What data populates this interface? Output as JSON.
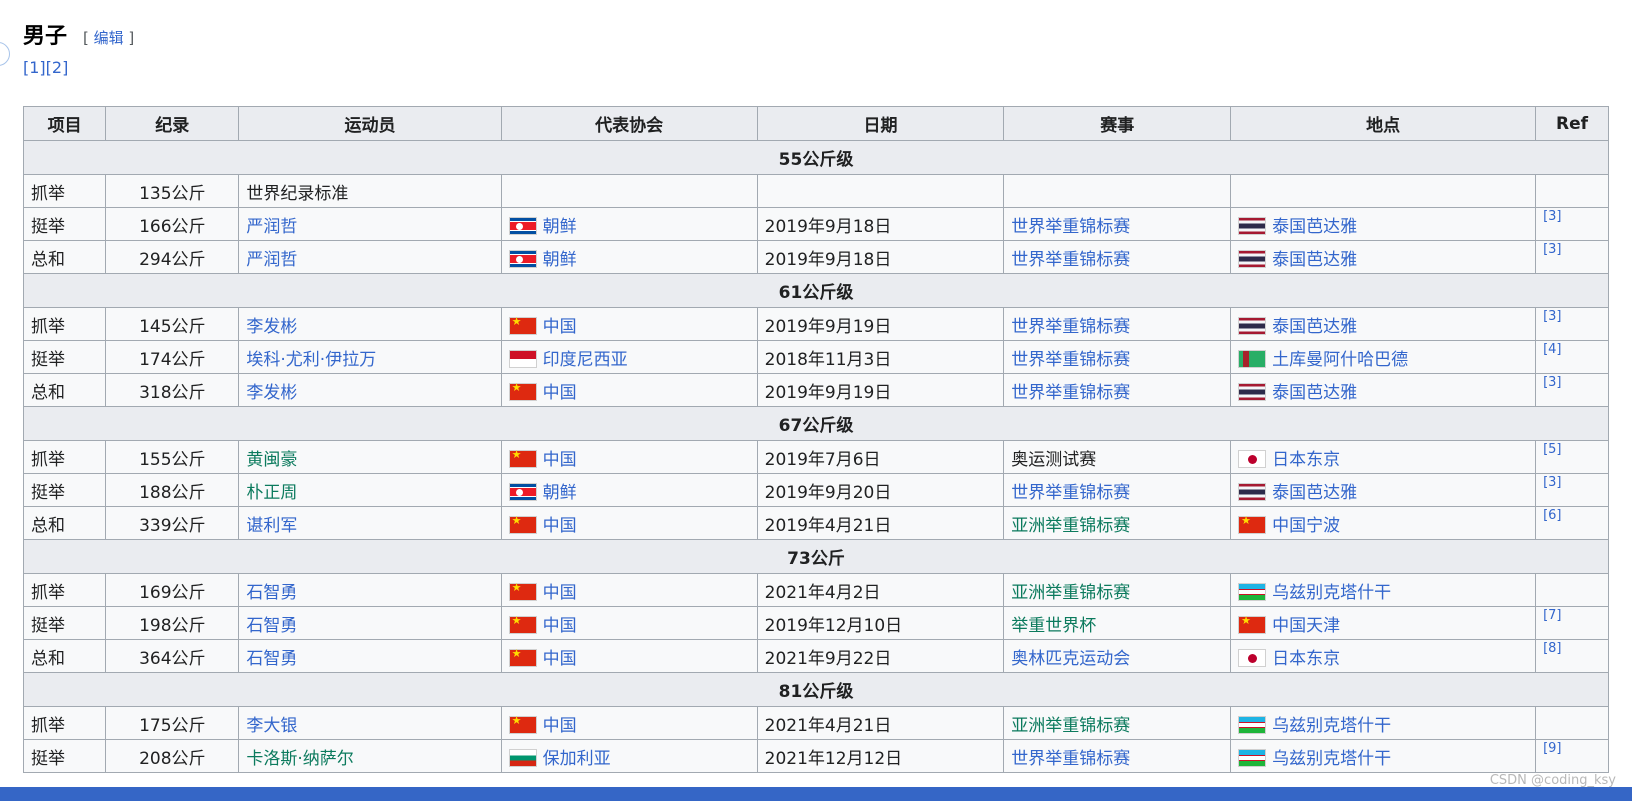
{
  "section": {
    "title": "男子",
    "edit_open": "[ ",
    "edit_label": "编辑",
    "edit_close": " ]",
    "ref1": "[1]",
    "ref2": "[2]"
  },
  "table": {
    "headers": [
      "项目",
      "纪录",
      "运动员",
      "代表协会",
      "日期",
      "赛事",
      "地点",
      "Ref"
    ],
    "groups": [
      "55公斤级",
      "61公斤级",
      "67公斤级",
      "73公斤",
      "81公斤级"
    ],
    "rows": [
      {
        "event": "抓举",
        "record": "135公斤",
        "athlete": "世界纪录标准",
        "nation": "",
        "date": "",
        "competition": "",
        "place": "",
        "ref": ""
      },
      {
        "event": "挺举",
        "record": "166公斤",
        "athlete": "严润哲",
        "nation": "朝鲜",
        "date": "2019年9月18日",
        "competition": "世界举重锦标赛",
        "place": "泰国芭达雅",
        "ref": "[3]"
      },
      {
        "event": "总和",
        "record": "294公斤",
        "athlete": "严润哲",
        "nation": "朝鲜",
        "date": "2019年9月18日",
        "competition": "世界举重锦标赛",
        "place": "泰国芭达雅",
        "ref": "[3]"
      },
      {
        "event": "抓举",
        "record": "145公斤",
        "athlete": "李发彬",
        "nation": "中国",
        "date": "2019年9月19日",
        "competition": "世界举重锦标赛",
        "place": "泰国芭达雅",
        "ref": "[3]"
      },
      {
        "event": "挺举",
        "record": "174公斤",
        "athlete": "埃科·尤利·伊拉万",
        "nation": "印度尼西亚",
        "date": "2018年11月3日",
        "competition": "世界举重锦标赛",
        "place": "土库曼阿什哈巴德",
        "ref": "[4]"
      },
      {
        "event": "总和",
        "record": "318公斤",
        "athlete": "李发彬",
        "nation": "中国",
        "date": "2019年9月19日",
        "competition": "世界举重锦标赛",
        "place": "泰国芭达雅",
        "ref": "[3]"
      },
      {
        "event": "抓举",
        "record": "155公斤",
        "athlete": "黄闽豪",
        "nation": "中国",
        "date": "2019年7月6日",
        "competition": "奥运测试赛",
        "place": "日本东京",
        "ref": "[5]"
      },
      {
        "event": "挺举",
        "record": "188公斤",
        "athlete": "朴正周",
        "nation": "朝鲜",
        "date": "2019年9月20日",
        "competition": "世界举重锦标赛",
        "place": "泰国芭达雅",
        "ref": "[3]"
      },
      {
        "event": "总和",
        "record": "339公斤",
        "athlete": "谌利军",
        "nation": "中国",
        "date": "2019年4月21日",
        "competition": "亚洲举重锦标赛",
        "place": "中国宁波",
        "ref": "[6]"
      },
      {
        "event": "抓举",
        "record": "169公斤",
        "athlete": "石智勇",
        "nation": "中国",
        "date": "2021年4月2日",
        "competition": "亚洲举重锦标赛",
        "place": "乌兹别克塔什干",
        "ref": ""
      },
      {
        "event": "挺举",
        "record": "198公斤",
        "athlete": "石智勇",
        "nation": "中国",
        "date": "2019年12月10日",
        "competition": "举重世界杯",
        "place": "中国天津",
        "ref": "[7]"
      },
      {
        "event": "总和",
        "record": "364公斤",
        "athlete": "石智勇",
        "nation": "中国",
        "date": "2021年9月22日",
        "competition": "奥林匹克运动会",
        "place": "日本东京",
        "ref": "[8]"
      },
      {
        "event": "抓举",
        "record": "175公斤",
        "athlete": "李大银",
        "nation": "中国",
        "date": "2021年4月21日",
        "competition": "亚洲举重锦标赛",
        "place": "乌兹别克塔什干",
        "ref": ""
      },
      {
        "event": "挺举",
        "record": "208公斤",
        "athlete": "卡洛斯·纳萨尔",
        "nation": "保加利亚",
        "date": "2021年12月12日",
        "competition": "世界举重锦标赛",
        "place": "乌兹别克塔什干",
        "ref": "[9]"
      }
    ]
  },
  "watermark": "CSDN @coding_ksy"
}
